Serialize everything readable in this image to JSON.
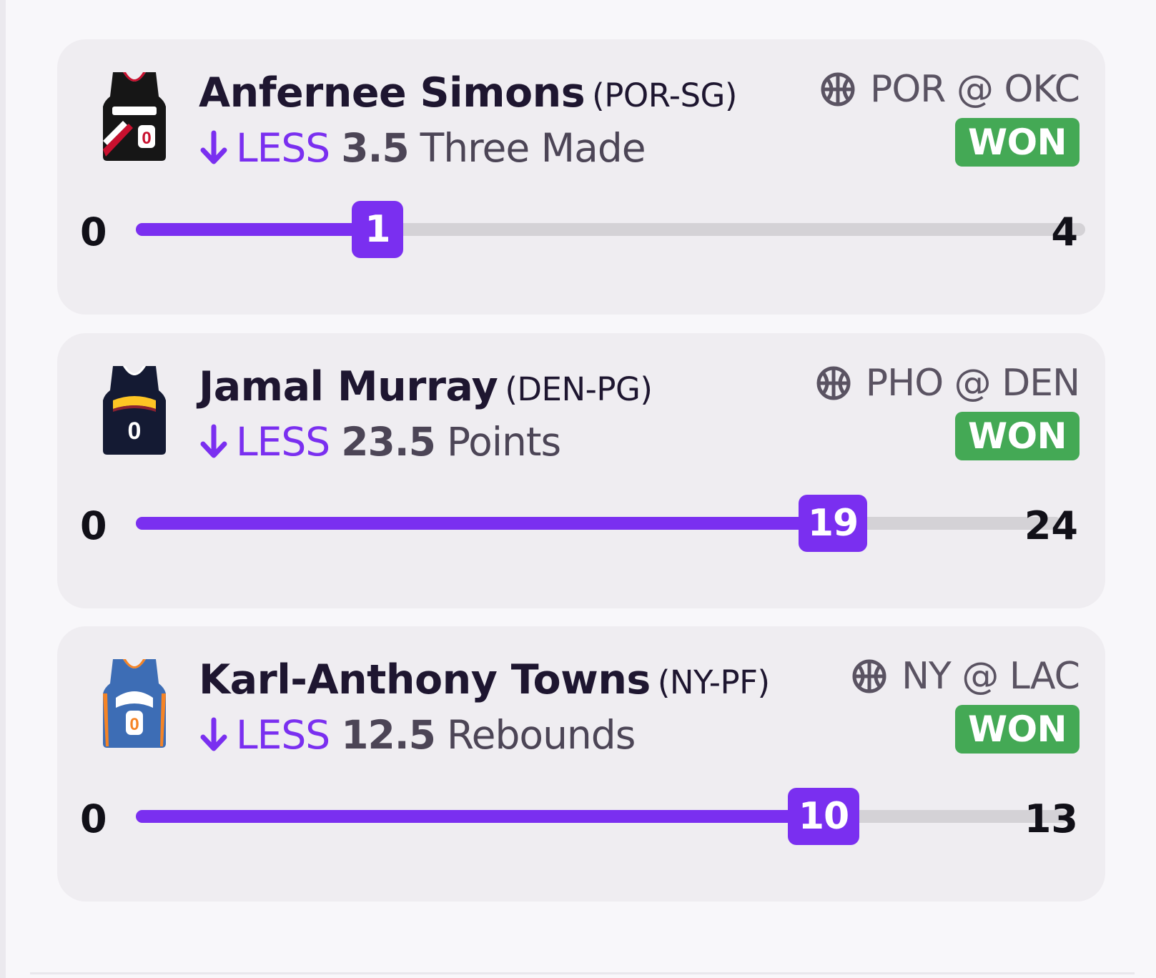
{
  "picks": [
    {
      "player": "Anfernee Simons",
      "team_position": "(POR-SG)",
      "direction": "LESS",
      "line": "3.5",
      "stat": "Three Made",
      "matchup": "POR @ OKC",
      "result": "WON",
      "scale_min": "0",
      "scale_max": "4",
      "actual": "1",
      "progress_fraction": 0.25,
      "jersey": {
        "name": "trail-blazers-jersey-icon",
        "number": "0",
        "colors": [
          "#161616",
          "#c8102e",
          "#ffffff"
        ]
      }
    },
    {
      "player": "Jamal Murray",
      "team_position": "(DEN-PG)",
      "direction": "LESS",
      "line": "23.5",
      "stat": "Points",
      "matchup": "PHO @ DEN",
      "result": "WON",
      "scale_min": "0",
      "scale_max": "24",
      "actual": "19",
      "progress_fraction": 0.7917,
      "jersey": {
        "name": "nuggets-jersey-icon",
        "number": "0",
        "colors": [
          "#141a33",
          "#fec524",
          "#8b2131"
        ]
      }
    },
    {
      "player": "Karl-Anthony Towns",
      "team_position": "(NY-PF)",
      "direction": "LESS",
      "line": "12.5",
      "stat": "Rebounds",
      "matchup": "NY @ LAC",
      "result": "WON",
      "scale_min": "0",
      "scale_max": "13",
      "actual": "10",
      "progress_fraction": 0.7692,
      "jersey": {
        "name": "knicks-jersey-icon",
        "number": "0",
        "colors": [
          "#3d6db5",
          "#f58426",
          "#ffffff"
        ]
      }
    }
  ],
  "colors": {
    "accent": "#7a2ff0",
    "won": "#44a955",
    "card_bg": "#efedf1",
    "track": "#d4d2d6"
  },
  "icons": {
    "arrow": "arrow-down-icon",
    "sport": "basketball-icon"
  }
}
